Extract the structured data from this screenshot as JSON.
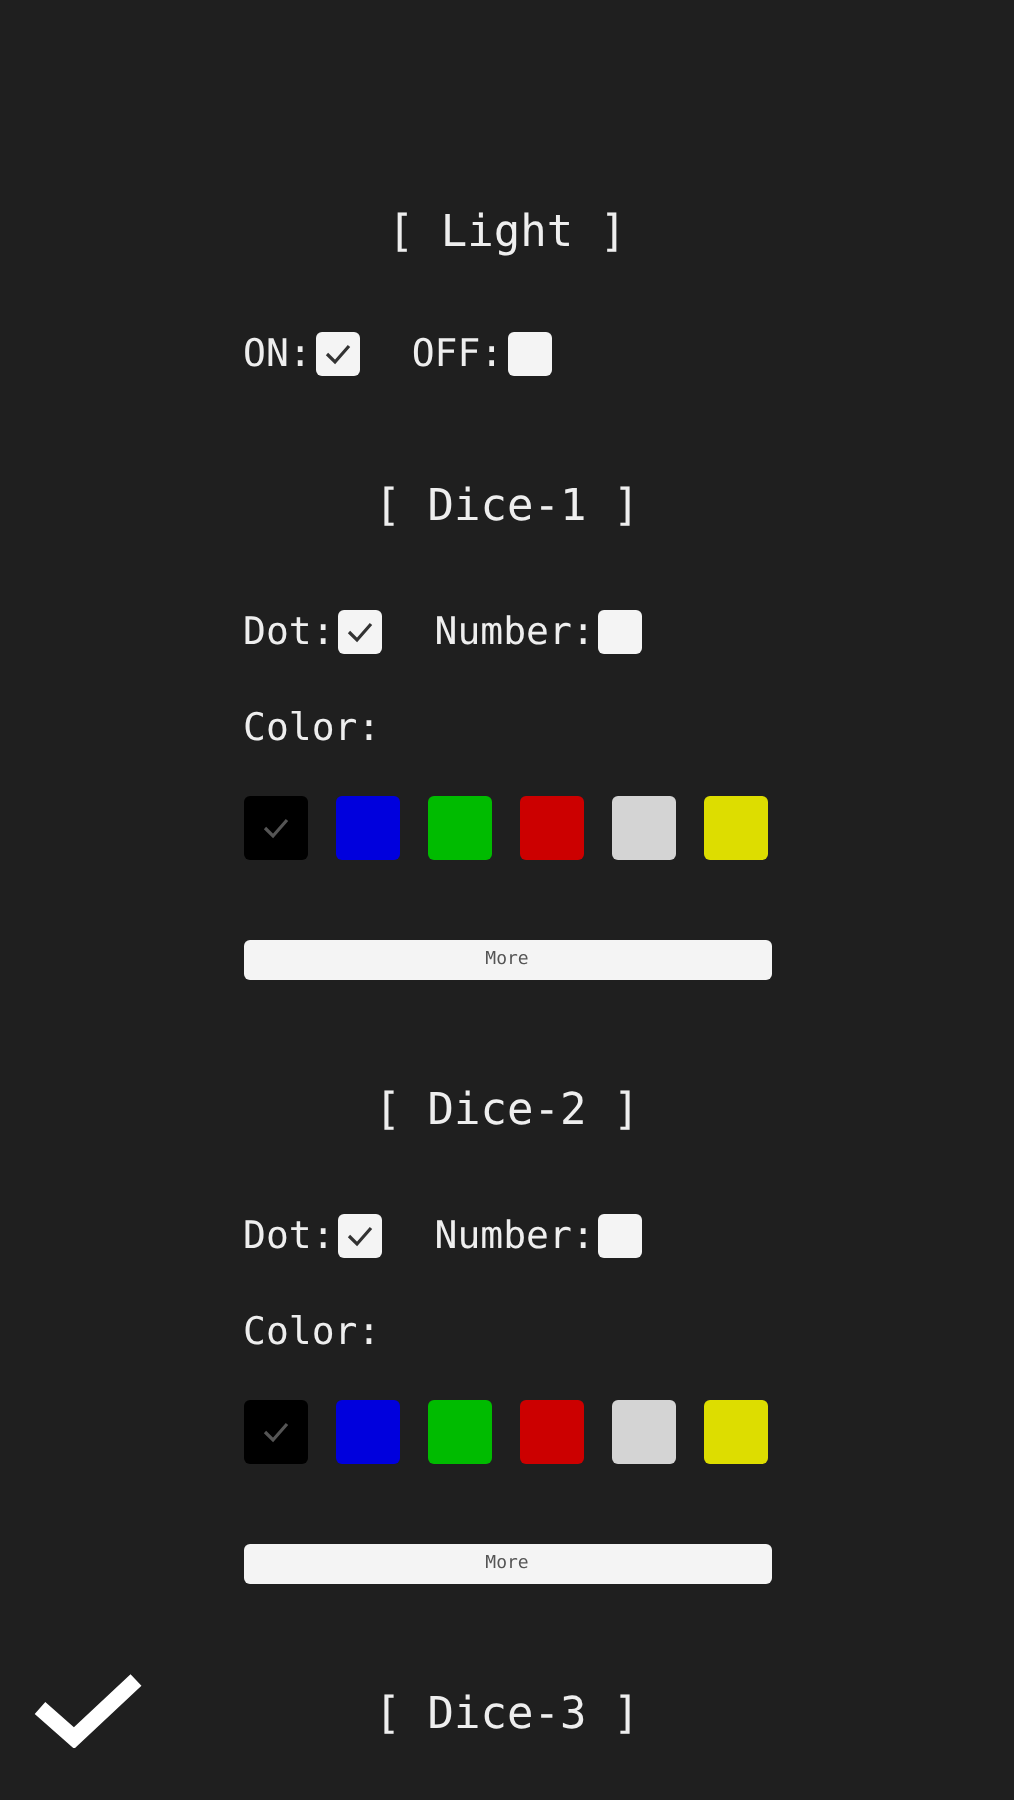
{
  "light": {
    "title": "[ Light ]",
    "options": [
      {
        "label": "ON:",
        "checked": true
      },
      {
        "label": "OFF:",
        "checked": false
      }
    ]
  },
  "dice": [
    {
      "title": "[ Dice-1 ]",
      "options": [
        {
          "label": "Dot:",
          "checked": true
        },
        {
          "label": "Number:",
          "checked": false
        }
      ],
      "color_label": "Color:",
      "colors": [
        {
          "color": "#000000",
          "selected": true
        },
        {
          "color": "#0000dd",
          "selected": false
        },
        {
          "color": "#00bb00",
          "selected": false
        },
        {
          "color": "#cc0000",
          "selected": false
        },
        {
          "color": "#d4d4d4",
          "selected": false
        },
        {
          "color": "#dddd00",
          "selected": false
        }
      ],
      "more_button": "More"
    },
    {
      "title": "[ Dice-2 ]",
      "options": [
        {
          "label": "Dot:",
          "checked": true
        },
        {
          "label": "Number:",
          "checked": false
        }
      ],
      "color_label": "Color:",
      "colors": [
        {
          "color": "#000000",
          "selected": true
        },
        {
          "color": "#0000dd",
          "selected": false
        },
        {
          "color": "#00bb00",
          "selected": false
        },
        {
          "color": "#cc0000",
          "selected": false
        },
        {
          "color": "#d4d4d4",
          "selected": false
        },
        {
          "color": "#dddd00",
          "selected": false
        }
      ],
      "more_button": "More"
    },
    {
      "title": "[ Dice-3 ]"
    }
  ]
}
